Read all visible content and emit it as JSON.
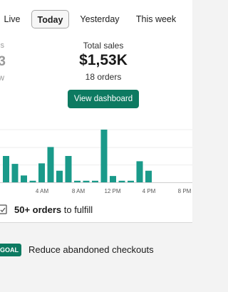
{
  "tabs": [
    {
      "label": "Live",
      "active": false
    },
    {
      "label": "Today",
      "active": true
    },
    {
      "label": "Yesterday",
      "active": false
    },
    {
      "label": "This week",
      "active": false
    }
  ],
  "side_metric": {
    "top": "s",
    "value": "3",
    "label": "w"
  },
  "metric": {
    "label": "Total sales",
    "value": "$1,53K",
    "sub": "18 orders"
  },
  "dashboard_button": "View dashboard",
  "chart_data": {
    "type": "bar",
    "x_ticks": [
      "4 AM",
      "8 AM",
      "12 PM",
      "4 PM",
      "8 PM"
    ],
    "values": [
      0.5,
      0.35,
      0.13,
      0.03,
      0.36,
      0.67,
      0.22,
      0.5,
      0.03,
      0.03,
      0.03,
      1.0,
      0.12,
      0.03,
      0.03,
      0.4,
      0.22
    ],
    "accent": "#1a9a8a"
  },
  "fulfill": {
    "count": "50+ orders",
    "suffix": " to fulfill"
  },
  "goal": {
    "badge": "GOAL",
    "text": "Reduce abandoned checkouts"
  }
}
